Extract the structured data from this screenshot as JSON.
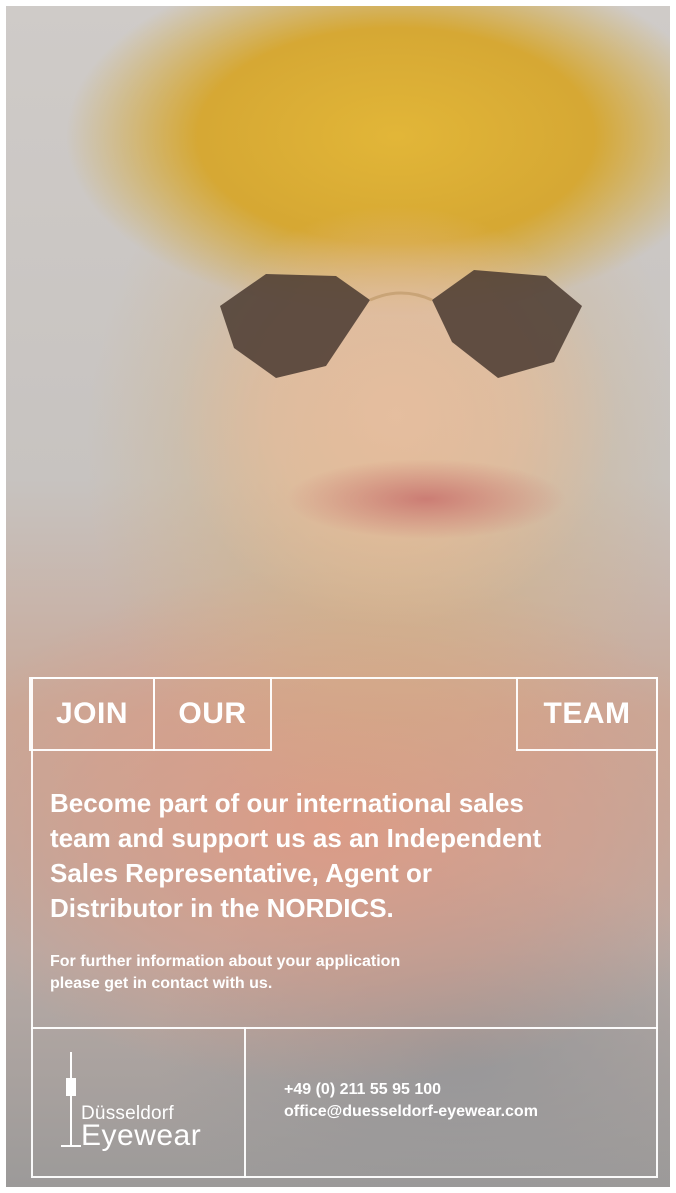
{
  "poster": {
    "join": "JOIN",
    "our": "OUR",
    "team": "TEAM",
    "headline_lines": [
      "Become part of our international sales",
      "team and support us as an Independent",
      "Sales Representative, Agent or",
      "Distributor in the NORDICS."
    ],
    "sub_lines": [
      "For further information about your application",
      "please get in contact with us."
    ],
    "phone": "+49 (0) 211 55 95 100",
    "email": "office@duesseldorf-eyewear.com"
  },
  "logo": {
    "line1": "Düsseldorf",
    "line2": "Eyewear"
  },
  "colors": {
    "hat": "#d9aa34",
    "frame_lines": "#ffffff",
    "lens": "#3a2a22"
  }
}
